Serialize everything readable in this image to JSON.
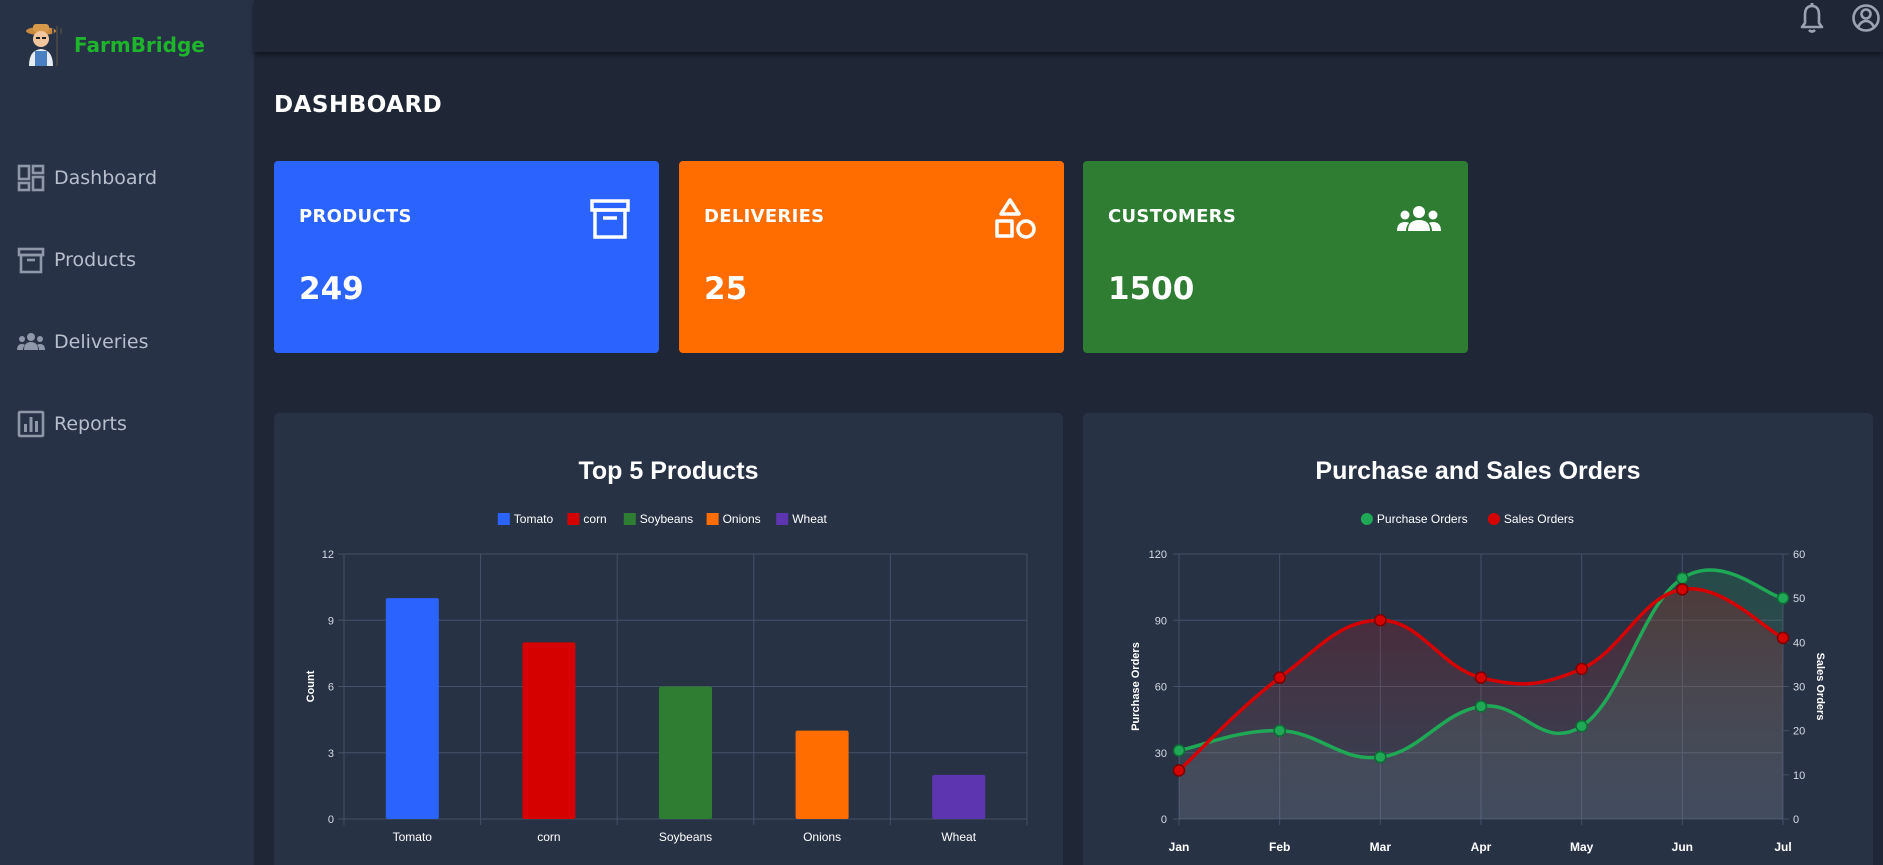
{
  "brand": {
    "name": "FarmBridge",
    "logo_icon": "farmer-icon"
  },
  "sidebar": {
    "items": [
      {
        "label": "Dashboard",
        "icon": "dashboard-icon"
      },
      {
        "label": "Products",
        "icon": "archive-box-icon"
      },
      {
        "label": "Deliveries",
        "icon": "users-group-icon"
      },
      {
        "label": "Reports",
        "icon": "bar-report-icon"
      }
    ]
  },
  "topbar": {
    "icons": [
      "bell-icon",
      "account-circle-icon"
    ]
  },
  "page": {
    "title": "DASHBOARD"
  },
  "cards": [
    {
      "title": "PRODUCTS",
      "value": "249",
      "icon": "archive-box-icon",
      "color": "#2b63ff"
    },
    {
      "title": "DELIVERIES",
      "value": "25",
      "icon": "shapes-icon",
      "color": "#ff6d00"
    },
    {
      "title": "CUSTOMERS",
      "value": "1500",
      "icon": "users-group-icon",
      "color": "#2e7d32"
    }
  ],
  "chart_data": [
    {
      "type": "bar",
      "title": "Top 5 Products",
      "categories": [
        "Tomato",
        "corn",
        "Soybeans",
        "Onions",
        "Wheat"
      ],
      "values": [
        10,
        8,
        6,
        4,
        2
      ],
      "colors": [
        "#2b63ff",
        "#d50000",
        "#2e7d32",
        "#ff6d00",
        "#5e35b1"
      ],
      "legend": [
        "Tomato",
        "corn",
        "Soybeans",
        "Onions",
        "Wheat"
      ],
      "legend_position": "top",
      "ylabel": "Count",
      "xlabel": "",
      "ylim": [
        0,
        12
      ],
      "yticks": [
        0,
        3,
        6,
        9,
        12
      ],
      "grid": true
    },
    {
      "type": "line",
      "title": "Purchase and Sales Orders",
      "x": [
        "Jan",
        "Feb",
        "Mar",
        "Apr",
        "May",
        "Jun",
        "Jul"
      ],
      "series": [
        {
          "name": "Purchase Orders",
          "axis": "left",
          "color": "#1fa855",
          "values": [
            31,
            40,
            28,
            51,
            42,
            109,
            100
          ]
        },
        {
          "name": "Sales Orders",
          "axis": "right",
          "color": "#d50000",
          "values": [
            11,
            32,
            45,
            32,
            34,
            52,
            41
          ]
        }
      ],
      "legend_position": "top",
      "ylabel_left": "Purchase Orders",
      "ylabel_right": "Sales Orders",
      "ylim_left": [
        0,
        120
      ],
      "ylim_right": [
        0,
        60
      ],
      "yticks_left": [
        0,
        30,
        60,
        90,
        120
      ],
      "yticks_right": [
        0,
        10,
        20,
        30,
        40,
        50,
        60
      ],
      "grid": true
    }
  ]
}
